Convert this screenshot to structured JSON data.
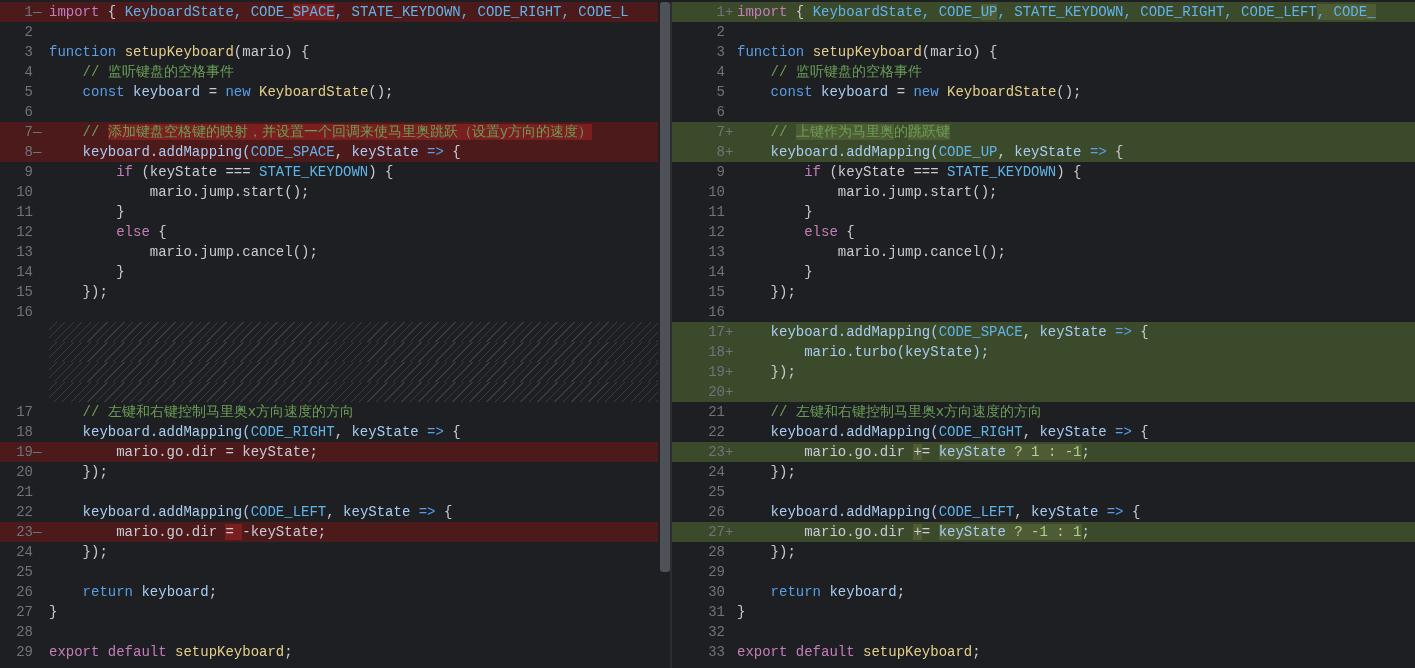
{
  "panes": [
    {
      "lines": [
        {
          "number": "1",
          "marker": "—",
          "kind": "removed",
          "tokens": [
            {
              "text": "import",
              "kind": "kw"
            },
            {
              "text": " { ",
              "kind": "plain"
            },
            {
              "text": "KeyboardState, CODE_",
              "kind": "const"
            },
            {
              "text": "SPACE",
              "kind": "const",
              "changed": true
            },
            {
              "text": ", STATE_KEYDOWN, CODE_RIGHT, CODE_L",
              "kind": "const"
            }
          ]
        },
        {
          "number": "2",
          "kind": "context"
        },
        {
          "number": "3",
          "kind": "context",
          "tokens": [
            {
              "text": "function ",
              "kind": "decl"
            },
            {
              "text": "setupKeyboard",
              "kind": "fn"
            },
            {
              "text": "(mario) {",
              "kind": "plain"
            }
          ]
        },
        {
          "number": "4",
          "kind": "context",
          "tokens": [
            {
              "text": "    // 监听键盘的空格事件",
              "kind": "comment"
            }
          ]
        },
        {
          "number": "5",
          "kind": "context",
          "tokens": [
            {
              "text": "    const ",
              "kind": "decl"
            },
            {
              "text": "keyboard",
              "kind": "ident"
            },
            {
              "text": " = ",
              "kind": "plain"
            },
            {
              "text": "new ",
              "kind": "decl"
            },
            {
              "text": "KeyboardState",
              "kind": "fn"
            },
            {
              "text": "();",
              "kind": "plain"
            }
          ]
        },
        {
          "number": "6",
          "kind": "context"
        },
        {
          "number": "7",
          "marker": "—",
          "kind": "removed",
          "tokens": [
            {
              "text": "    // ",
              "kind": "comment"
            },
            {
              "text": "添加键盘空格键的映射，并设置一个回调来使马里奥跳跃（设置y方向的速度）",
              "kind": "comment",
              "changed": true
            }
          ]
        },
        {
          "number": "8",
          "marker": "—",
          "kind": "removed",
          "tokens": [
            {
              "text": "    keyboard.addMapping(",
              "kind": "ident"
            },
            {
              "text": "CODE_SPACE",
              "kind": "const"
            },
            {
              "text": ", ",
              "kind": "plain"
            },
            {
              "text": "keyState",
              "kind": "ident"
            },
            {
              "text": " => ",
              "kind": "decl"
            },
            {
              "text": "{",
              "kind": "plain"
            }
          ]
        },
        {
          "number": "9",
          "kind": "context",
          "tokens": [
            {
              "text": "        if ",
              "kind": "kw"
            },
            {
              "text": "(keyState === ",
              "kind": "plain"
            },
            {
              "text": "STATE_KEYDOWN",
              "kind": "const"
            },
            {
              "text": ") {",
              "kind": "plain"
            }
          ]
        },
        {
          "number": "10",
          "kind": "context",
          "tokens": [
            {
              "text": "            mario.jump.start();",
              "kind": "plain"
            }
          ]
        },
        {
          "number": "11",
          "kind": "context",
          "tokens": [
            {
              "text": "        }",
              "kind": "plain"
            }
          ]
        },
        {
          "number": "12",
          "kind": "context",
          "tokens": [
            {
              "text": "        else ",
              "kind": "kw"
            },
            {
              "text": "{",
              "kind": "plain"
            }
          ]
        },
        {
          "number": "13",
          "kind": "context",
          "tokens": [
            {
              "text": "            mario.jump.cancel();",
              "kind": "plain"
            }
          ]
        },
        {
          "number": "14",
          "kind": "context",
          "tokens": [
            {
              "text": "        }",
              "kind": "plain"
            }
          ]
        },
        {
          "number": "15",
          "kind": "context",
          "tokens": [
            {
              "text": "    });",
              "kind": "plain"
            }
          ]
        },
        {
          "number": "16",
          "kind": "context"
        },
        {
          "kind": "filler"
        },
        {
          "kind": "filler"
        },
        {
          "kind": "filler"
        },
        {
          "kind": "filler"
        },
        {
          "number": "17",
          "kind": "context",
          "tokens": [
            {
              "text": "    // 左键和右键控制马里奥x方向速度的方向",
              "kind": "comment"
            }
          ]
        },
        {
          "number": "18",
          "kind": "context",
          "tokens": [
            {
              "text": "    keyboard.addMapping(",
              "kind": "ident"
            },
            {
              "text": "CODE_RIGHT",
              "kind": "const"
            },
            {
              "text": ", ",
              "kind": "plain"
            },
            {
              "text": "keyState",
              "kind": "ident"
            },
            {
              "text": " => ",
              "kind": "decl"
            },
            {
              "text": "{",
              "kind": "plain"
            }
          ]
        },
        {
          "number": "19",
          "marker": "—",
          "kind": "removed",
          "tokens": [
            {
              "text": "        mario.go.dir = keyState;",
              "kind": "plain"
            }
          ]
        },
        {
          "number": "20",
          "kind": "context",
          "tokens": [
            {
              "text": "    });",
              "kind": "plain"
            }
          ]
        },
        {
          "number": "21",
          "kind": "context"
        },
        {
          "number": "22",
          "kind": "context",
          "tokens": [
            {
              "text": "    keyboard.addMapping(",
              "kind": "ident"
            },
            {
              "text": "CODE_LEFT",
              "kind": "const"
            },
            {
              "text": ", ",
              "kind": "plain"
            },
            {
              "text": "keyState",
              "kind": "ident"
            },
            {
              "text": " => ",
              "kind": "decl"
            },
            {
              "text": "{",
              "kind": "plain"
            }
          ]
        },
        {
          "number": "23",
          "marker": "—",
          "kind": "removed",
          "tokens": [
            {
              "text": "        mario.go.dir ",
              "kind": "plain"
            },
            {
              "text": "= ",
              "kind": "plain",
              "changed": true
            },
            {
              "text": "-keyState;",
              "kind": "plain"
            }
          ]
        },
        {
          "number": "24",
          "kind": "context",
          "tokens": [
            {
              "text": "    });",
              "kind": "plain"
            }
          ]
        },
        {
          "number": "25",
          "kind": "context"
        },
        {
          "number": "26",
          "kind": "context",
          "tokens": [
            {
              "text": "    return ",
              "kind": "decl"
            },
            {
              "text": "keyboard",
              "kind": "ident"
            },
            {
              "text": ";",
              "kind": "plain"
            }
          ]
        },
        {
          "number": "27",
          "kind": "context",
          "tokens": [
            {
              "text": "}",
              "kind": "plain"
            }
          ]
        },
        {
          "number": "28",
          "kind": "context"
        },
        {
          "number": "29",
          "kind": "context",
          "tokens": [
            {
              "text": "export default ",
              "kind": "kw"
            },
            {
              "text": "setupKeyboard",
              "kind": "fn"
            },
            {
              "text": ";",
              "kind": "plain"
            }
          ]
        }
      ]
    },
    {
      "lines": [
        {
          "number": "1",
          "marker": "+",
          "kind": "added",
          "tokens": [
            {
              "text": "import",
              "kind": "kw"
            },
            {
              "text": " { ",
              "kind": "plain"
            },
            {
              "text": "KeyboardState, CODE_",
              "kind": "const"
            },
            {
              "text": "UP",
              "kind": "const",
              "changed": true
            },
            {
              "text": ", STATE_KEYDOWN, CODE_RIGHT, CODE_LEFT",
              "kind": "const"
            },
            {
              "text": ", CODE_",
              "kind": "const",
              "changed": true
            }
          ]
        },
        {
          "number": "2",
          "kind": "context"
        },
        {
          "number": "3",
          "kind": "context",
          "tokens": [
            {
              "text": "function ",
              "kind": "decl"
            },
            {
              "text": "setupKeyboard",
              "kind": "fn"
            },
            {
              "text": "(mario) {",
              "kind": "plain"
            }
          ]
        },
        {
          "number": "4",
          "kind": "context",
          "tokens": [
            {
              "text": "    // 监听键盘的空格事件",
              "kind": "comment"
            }
          ]
        },
        {
          "number": "5",
          "kind": "context",
          "tokens": [
            {
              "text": "    const ",
              "kind": "decl"
            },
            {
              "text": "keyboard",
              "kind": "ident"
            },
            {
              "text": " = ",
              "kind": "plain"
            },
            {
              "text": "new ",
              "kind": "decl"
            },
            {
              "text": "KeyboardState",
              "kind": "fn"
            },
            {
              "text": "();",
              "kind": "plain"
            }
          ]
        },
        {
          "number": "6",
          "kind": "context"
        },
        {
          "number": "7",
          "marker": "+",
          "kind": "added",
          "tokens": [
            {
              "text": "    // ",
              "kind": "comment"
            },
            {
              "text": "上键作为马里奥",
              "kind": "comment",
              "changed": true
            },
            {
              "text": "的",
              "kind": "comment"
            },
            {
              "text": "跳跃键",
              "kind": "comment",
              "changed": true
            }
          ]
        },
        {
          "number": "8",
          "marker": "+",
          "kind": "added",
          "tokens": [
            {
              "text": "    keyboard.addMapping(",
              "kind": "ident"
            },
            {
              "text": "CODE_UP",
              "kind": "const"
            },
            {
              "text": ", ",
              "kind": "plain"
            },
            {
              "text": "keyState",
              "kind": "ident"
            },
            {
              "text": " => ",
              "kind": "decl"
            },
            {
              "text": "{",
              "kind": "plain"
            }
          ]
        },
        {
          "number": "9",
          "kind": "context",
          "tokens": [
            {
              "text": "        if ",
              "kind": "kw"
            },
            {
              "text": "(keyState === ",
              "kind": "plain"
            },
            {
              "text": "STATE_KEYDOWN",
              "kind": "const"
            },
            {
              "text": ") {",
              "kind": "plain"
            }
          ]
        },
        {
          "number": "10",
          "kind": "context",
          "tokens": [
            {
              "text": "            mario.jump.start();",
              "kind": "plain"
            }
          ]
        },
        {
          "number": "11",
          "kind": "context",
          "tokens": [
            {
              "text": "        }",
              "kind": "plain"
            }
          ]
        },
        {
          "number": "12",
          "kind": "context",
          "tokens": [
            {
              "text": "        else ",
              "kind": "kw"
            },
            {
              "text": "{",
              "kind": "plain"
            }
          ]
        },
        {
          "number": "13",
          "kind": "context",
          "tokens": [
            {
              "text": "            mario.jump.cancel();",
              "kind": "plain"
            }
          ]
        },
        {
          "number": "14",
          "kind": "context",
          "tokens": [
            {
              "text": "        }",
              "kind": "plain"
            }
          ]
        },
        {
          "number": "15",
          "kind": "context",
          "tokens": [
            {
              "text": "    });",
              "kind": "plain"
            }
          ]
        },
        {
          "number": "16",
          "kind": "context"
        },
        {
          "number": "17",
          "marker": "+",
          "kind": "added",
          "tokens": [
            {
              "text": "    keyboard.addMapping(",
              "kind": "ident"
            },
            {
              "text": "CODE_SPACE",
              "kind": "const"
            },
            {
              "text": ", ",
              "kind": "plain"
            },
            {
              "text": "keyState",
              "kind": "ident"
            },
            {
              "text": " => ",
              "kind": "decl"
            },
            {
              "text": "{",
              "kind": "plain"
            }
          ]
        },
        {
          "number": "18",
          "marker": "+",
          "kind": "added",
          "tokens": [
            {
              "text": "        mario.turbo(keyState);",
              "kind": "ident"
            }
          ]
        },
        {
          "number": "19",
          "marker": "+",
          "kind": "added",
          "tokens": [
            {
              "text": "    });",
              "kind": "plain"
            }
          ]
        },
        {
          "number": "20",
          "marker": "+",
          "kind": "added"
        },
        {
          "number": "21",
          "kind": "context",
          "tokens": [
            {
              "text": "    // 左键和右键控制马里奥x方向速度的方向",
              "kind": "comment"
            }
          ]
        },
        {
          "number": "22",
          "kind": "context",
          "tokens": [
            {
              "text": "    keyboard.addMapping(",
              "kind": "ident"
            },
            {
              "text": "CODE_RIGHT",
              "kind": "const"
            },
            {
              "text": ", ",
              "kind": "plain"
            },
            {
              "text": "keyState",
              "kind": "ident"
            },
            {
              "text": " => ",
              "kind": "decl"
            },
            {
              "text": "{",
              "kind": "plain"
            }
          ]
        },
        {
          "number": "23",
          "marker": "+",
          "kind": "added",
          "tokens": [
            {
              "text": "        mario.go.dir ",
              "kind": "plain"
            },
            {
              "text": "+",
              "kind": "plain",
              "changed": true
            },
            {
              "text": "= ",
              "kind": "plain"
            },
            {
              "text": "keyState",
              "kind": "ident",
              "changed": true
            },
            {
              "text": " ? 1 : -1",
              "kind": "num",
              "changed": true
            },
            {
              "text": ";",
              "kind": "plain"
            }
          ]
        },
        {
          "number": "24",
          "kind": "context",
          "tokens": [
            {
              "text": "    });",
              "kind": "plain"
            }
          ]
        },
        {
          "number": "25",
          "kind": "context"
        },
        {
          "number": "26",
          "kind": "context",
          "tokens": [
            {
              "text": "    keyboard.addMapping(",
              "kind": "ident"
            },
            {
              "text": "CODE_LEFT",
              "kind": "const"
            },
            {
              "text": ", ",
              "kind": "plain"
            },
            {
              "text": "keyState",
              "kind": "ident"
            },
            {
              "text": " => ",
              "kind": "decl"
            },
            {
              "text": "{",
              "kind": "plain"
            }
          ]
        },
        {
          "number": "27",
          "marker": "+",
          "kind": "added",
          "tokens": [
            {
              "text": "        mario.go.dir ",
              "kind": "plain"
            },
            {
              "text": "+",
              "kind": "plain",
              "changed": true
            },
            {
              "text": "= ",
              "kind": "plain"
            },
            {
              "text": "keyState",
              "kind": "ident",
              "changed": true
            },
            {
              "text": " ? -1 : 1",
              "kind": "num",
              "changed": true
            },
            {
              "text": ";",
              "kind": "plain"
            }
          ]
        },
        {
          "number": "28",
          "kind": "context",
          "tokens": [
            {
              "text": "    });",
              "kind": "plain"
            }
          ]
        },
        {
          "number": "29",
          "kind": "context"
        },
        {
          "number": "30",
          "kind": "context",
          "tokens": [
            {
              "text": "    return ",
              "kind": "decl"
            },
            {
              "text": "keyboard",
              "kind": "ident"
            },
            {
              "text": ";",
              "kind": "plain"
            }
          ]
        },
        {
          "number": "31",
          "kind": "context",
          "tokens": [
            {
              "text": "}",
              "kind": "plain"
            }
          ]
        },
        {
          "number": "32",
          "kind": "context"
        },
        {
          "number": "33",
          "kind": "context",
          "tokens": [
            {
              "text": "export default ",
              "kind": "kw"
            },
            {
              "text": "setupKeyboard",
              "kind": "fn"
            },
            {
              "text": ";",
              "kind": "plain"
            }
          ]
        }
      ]
    }
  ]
}
